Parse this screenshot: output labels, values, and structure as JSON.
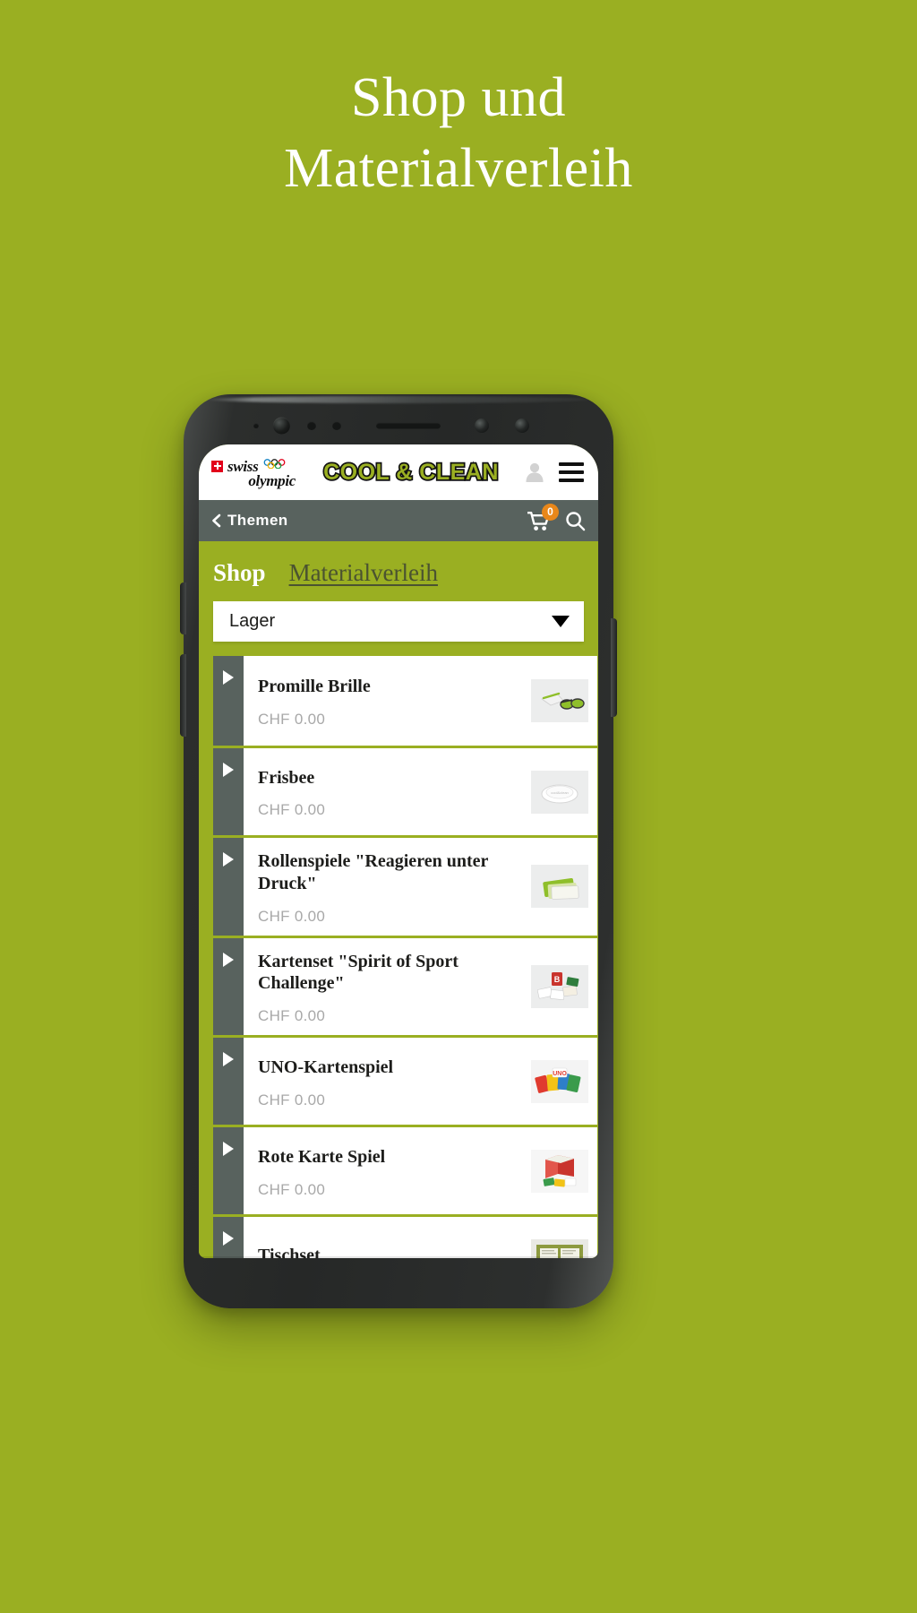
{
  "page": {
    "background_color": "#9aaf22",
    "heading_lines": [
      "Shop und",
      "Materialverleih"
    ]
  },
  "device": {
    "frame_color": "#262827",
    "icons": {
      "camera": "camera-icon",
      "proximity_sensor": "proximity-sensor-icon",
      "light_sensor": "light-sensor-icon",
      "earpiece_speaker": "speaker-icon",
      "front_lens": "lens-icon"
    }
  },
  "app_header": {
    "brand_left": {
      "swiss": "swiss",
      "olympic": "olympic",
      "cross_color": "#e2001a",
      "icon_rings": "olympic-rings-icon",
      "icon_cross": "swiss-cross-icon"
    },
    "brand_title": "COOL & CLEAN",
    "brand_title_color": "#9aaf22",
    "brand_title_outline": "#111111",
    "account_icon": "user-icon",
    "menu_icon": "hamburger-menu-icon"
  },
  "navbar": {
    "background_color": "#58625e",
    "back_icon": "chevron-left-icon",
    "title": "Themen",
    "cart_icon": "shopping-cart-icon",
    "cart_count": "0",
    "cart_badge_color": "#e8871a",
    "search_icon": "search-icon"
  },
  "tabs": [
    {
      "label": "Shop",
      "active": true
    },
    {
      "label": "Materialverleih",
      "active": false
    }
  ],
  "filter": {
    "selected": "Lager",
    "caret_icon": "chevron-down-icon"
  },
  "products": [
    {
      "title": "Promille Brille",
      "price": "CHF 0.00",
      "expand_icon": "play-triangle-icon",
      "thumb": "goggles-thumb"
    },
    {
      "title": "Frisbee",
      "price": "CHF 0.00",
      "expand_icon": "play-triangle-icon",
      "thumb": "frisbee-thumb"
    },
    {
      "title": "Rollenspiele \"Reagieren unter Druck\"",
      "price": "CHF 0.00",
      "expand_icon": "play-triangle-icon",
      "thumb": "cards-green-thumb"
    },
    {
      "title": "Kartenset \"Spirit of Sport Challenge\"",
      "price": "CHF 0.00",
      "expand_icon": "play-triangle-icon",
      "thumb": "cardset-thumb"
    },
    {
      "title": "UNO-Kartenspiel",
      "price": "CHF 0.00",
      "expand_icon": "play-triangle-icon",
      "thumb": "uno-thumb"
    },
    {
      "title": "Rote Karte Spiel",
      "price": "CHF 0.00",
      "expand_icon": "play-triangle-icon",
      "thumb": "redcard-thumb"
    },
    {
      "title": "Tischset",
      "price": "",
      "expand_icon": "play-triangle-icon",
      "thumb": "tischset-thumb"
    }
  ]
}
